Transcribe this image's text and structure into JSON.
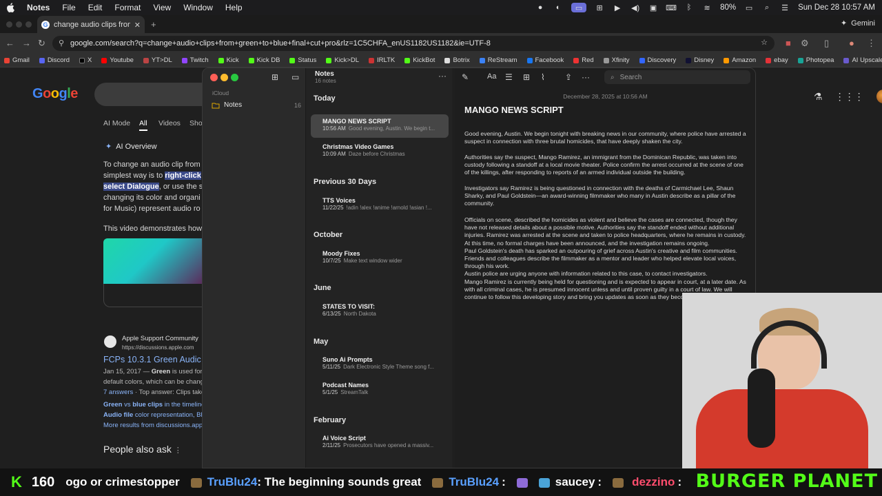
{
  "menubar": {
    "app": "Notes",
    "menus": [
      "File",
      "Edit",
      "Format",
      "View",
      "Window",
      "Help"
    ],
    "battery": "80%",
    "clock": "Sun Dec 28  10:57 AM"
  },
  "browser": {
    "tab_title": "change audio clips from gree",
    "url": "google.com/search?q=change+audio+clips+from+green+to+blue+final+cut+pro&rlz=1C5CHFA_enUS1182US1182&ie=UTF-8",
    "gemini_label": "Gemini",
    "bookmarks": [
      "Gmail",
      "Discord",
      "X",
      "Youtube",
      "YT>DL",
      "Twitch",
      "Kick",
      "Kick DB",
      "Status",
      "Kick>DL",
      "IRLTK",
      "KickBot",
      "Botrix",
      "ReStream",
      "Facebook",
      "Red",
      "Xfinity",
      "Discovery",
      "Disney",
      "Amazon",
      "ebay",
      "Photopea",
      "AI Upscaler"
    ]
  },
  "google": {
    "logo": "Google",
    "tabs": [
      "AI Mode",
      "All",
      "Videos",
      "Sho"
    ],
    "ai_overview": "AI Overview",
    "lines": [
      "To change an audio clip from",
      "simplest way is to ",
      "right-click",
      "select Dialogue",
      ", or use the s",
      "changing its color and organi",
      "for Music) represent audio ro"
    ],
    "video_caption": "This video demonstrates how",
    "source_name": "Apple Support Community",
    "source_url": "https://discussions.apple.com",
    "result_title": "FCPs 10.3.1 Green Audic",
    "result_date": "Jan 15, 2017 — ",
    "result_bold": "Green",
    "result_rest": " is used for",
    "result_line2": "default colors, which can be chang",
    "answers": "7 answers",
    "answers_rest": " · Top answer: Clips take",
    "rel1a": "Green",
    "rel1b": " vs ",
    "rel1c": "blue clips",
    "rel1d": " in the timeline",
    "rel2a": "Audio file",
    "rel2b": " color representation, Blu",
    "rel3": "More results from discussions.app",
    "paa": "People also ask"
  },
  "notes": {
    "icloud": "iCloud",
    "folder": "Notes",
    "folder_count": "16",
    "list_title": "Notes",
    "list_sub": "16 notes",
    "sections": [
      {
        "label": "Today"
      },
      {
        "label": "Previous 30 Days"
      },
      {
        "label": "October"
      },
      {
        "label": "June"
      },
      {
        "label": "May"
      },
      {
        "label": "February"
      }
    ],
    "items": [
      {
        "title": "MANGO NEWS SCRIPT",
        "meta": "10:56 AM",
        "preview": "Good evening, Austin. We begin t..."
      },
      {
        "title": "Christmas Video Games",
        "meta": "10:09 AM",
        "preview": "Daze before Christmas"
      },
      {
        "title": "TTS Voices",
        "meta": "11/22/25",
        "preview": "!adin !alex !anime !arnold !asian !..."
      },
      {
        "title": "Moody Fixes",
        "meta": "10/7/25",
        "preview": "Make text window wider"
      },
      {
        "title": "STATES TO VISIT:",
        "meta": "6/13/25",
        "preview": "North Dakota"
      },
      {
        "title": "Suno Ai Prompts",
        "meta": "5/11/25",
        "preview": "Dark Electronic Style Theme song f..."
      },
      {
        "title": "Podcast Names",
        "meta": "5/1/25",
        "preview": "StreamTalk"
      },
      {
        "title": "Ai Voice Script",
        "meta": "2/11/25",
        "preview": "Prosecutors have opened a massiv..."
      }
    ],
    "search_placeholder": "Search",
    "date": "December 28, 2025 at 10:56 AM",
    "title": "MANGO NEWS SCRIPT",
    "paragraphs": [
      "Good evening, Austin. We begin tonight with breaking news in our community, where police have arrested a suspect in connection with three brutal homicides, that have deeply shaken the city.",
      "Authorities say the suspect, Mango Ramirez, an immigrant from the Dominican Republic, was taken into custody following a standoff at a local movie theater. Police confirm the arrest occurred at the scene of one of the killings, after responding to reports of an armed individual outside the building.",
      "Investigators say Ramirez is being questioned in connection with the deaths of Carmichael Lee, Shaun Sharky, and Paul Goldstein—an award-winning filmmaker who many in Austin describe as a pillar of the community.",
      "Officials on scene, described the homicides as violent and believe the cases are connected, though they have not released details about a possible motive. Authorities say the standoff ended without additional injuries. Ramirez was arrested at the scene and taken to police headquarters, where he remains in custody. At this time, no formal charges have been announced, and the investigation remains ongoing.\nPaul Goldstein's death has sparked an outpouring of grief across Austin's creative and film communities. Friends and colleagues describe the filmmaker as a mentor and leader who helped elevate local voices, through his work.\nAustin police are urging anyone with information related to this case, to contact investigators.\nMango Ramirez is currently being held for questioning and is expected to appear in court, at a later date. As with all criminal cases, he is presumed innocent unless and until proven guilty in a court of law. We will continue to follow this developing story and bring you updates as soon as they become available."
    ]
  },
  "ticker": {
    "count": "160",
    "msg1": "ogo or crimestopper",
    "user1": "TruBlu24",
    "msg2": ": The beginning sounds great",
    "user2": "TruBlu24",
    "msg3": ":",
    "user3": "saucey",
    "msg4": ":",
    "user4": "dezzino",
    "msg5": ":",
    "brand": "BURGER PLANET"
  }
}
